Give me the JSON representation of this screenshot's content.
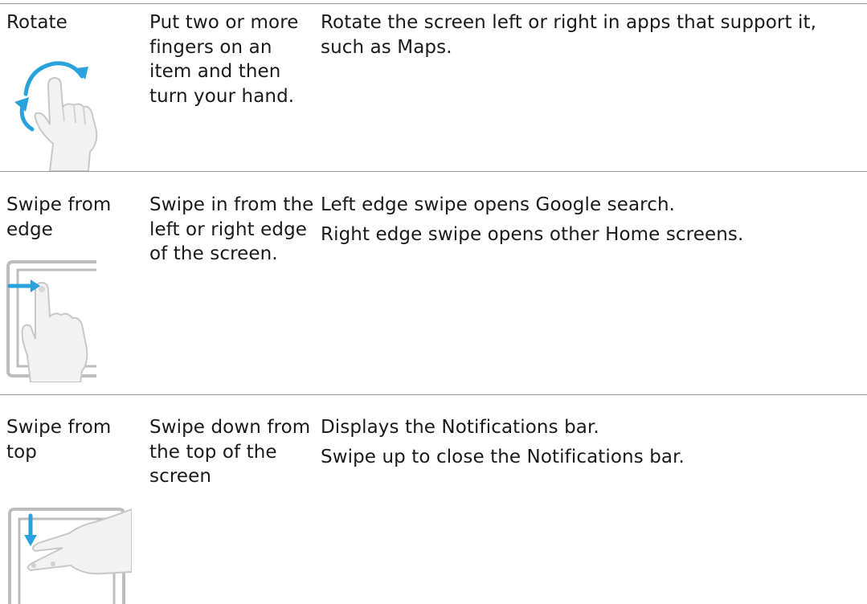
{
  "rows": [
    {
      "gesture": "Rotate",
      "how": "Put two or more fingers on an item and then turn your hand.",
      "result": [
        "Rotate the screen left or right in apps that support it, such as Maps."
      ],
      "icon": "rotate-gesture-icon"
    },
    {
      "gesture": "Swipe from edge",
      "how": "Swipe in from the left or right edge of the screen.",
      "result": [
        "Left edge swipe opens Google search.",
        "Right edge swipe opens other Home screens."
      ],
      "icon": "swipe-from-edge-gesture-icon"
    },
    {
      "gesture": "Swipe from top",
      "how": "Swipe down from the top of the screen",
      "result": [
        "Displays the Notifications bar.",
        "Swipe up to close the Notifications bar."
      ],
      "icon": "swipe-from-top-gesture-icon"
    }
  ],
  "colors": {
    "accent": "#2aa3dc",
    "rule": "#9a9a9a",
    "text": "#1a1a1a"
  }
}
